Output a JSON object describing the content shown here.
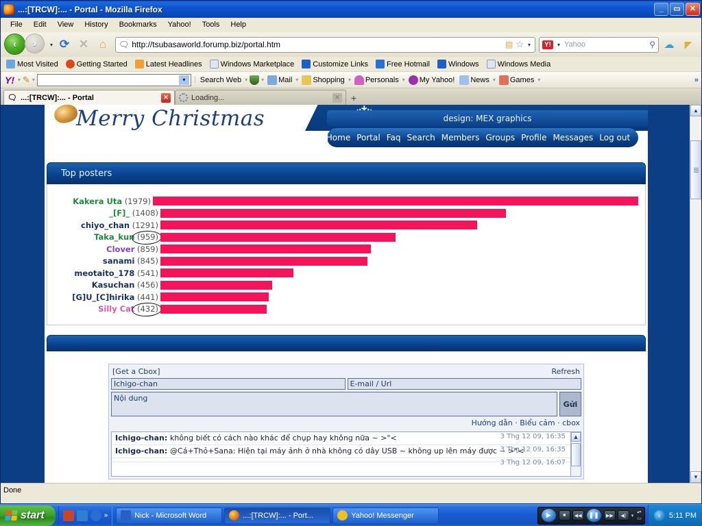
{
  "window": {
    "title": "...:[TRCW]:... - Portal - Mozilla Firefox",
    "minimize": "_",
    "maximize": "▭",
    "close": "✕"
  },
  "menu": [
    "File",
    "Edit",
    "View",
    "History",
    "Bookmarks",
    "Yahoo!",
    "Tools",
    "Help"
  ],
  "toolbar": {
    "back_icon": "‹",
    "forward_icon": "›",
    "reload_icon": "⟳",
    "stop_icon": "✕",
    "home_icon": "⌂",
    "url": "http://tsubasaworld.forump.biz/portal.htm",
    "feed_icon": "rss-icon",
    "star_icon": "☆",
    "search_placeholder": "Yahoo",
    "search_badge": "Y!",
    "search_icon": "search-icon",
    "skype_icon": "skype-icon",
    "megaphone_icon": "megaphone-icon"
  },
  "bookmarks": [
    {
      "label": "Most Visited",
      "icon": "globe-icon",
      "color": "#6aa9e0"
    },
    {
      "label": "Getting Started",
      "icon": "firefox-icon",
      "color": "#d94b1a"
    },
    {
      "label": "Latest Headlines",
      "icon": "rss-icon",
      "color": "#f2a033"
    },
    {
      "label": "Windows Marketplace",
      "icon": "page-icon",
      "color": "#dfe6f2"
    },
    {
      "label": "Customize Links",
      "icon": "msn-icon",
      "color": "#1d5fc4"
    },
    {
      "label": "Free Hotmail",
      "icon": "hotmail-icon",
      "color": "#2a6fd4"
    },
    {
      "label": "Windows",
      "icon": "msn-icon",
      "color": "#1d5fc4"
    },
    {
      "label": "Windows Media",
      "icon": "page-icon",
      "color": "#dfe6f2"
    }
  ],
  "yahoo_toolbar": {
    "logo": "Y!",
    "pencil_icon": "pencil-icon",
    "search_value": "",
    "items": [
      {
        "label": "Search Web",
        "icon": "search-web-icon",
        "color": "#2f6fbf"
      },
      {
        "label": "",
        "icon": "shield-icon",
        "color": "#4b7a3a"
      },
      {
        "label": "Mail",
        "icon": "envelope-icon",
        "color": "#7fa8dd"
      },
      {
        "label": "Shopping",
        "icon": "bag-icon",
        "color": "#e8c558"
      },
      {
        "label": "Personals",
        "icon": "heart-icon",
        "color": "#d060c0"
      },
      {
        "label": "My Yahoo!",
        "icon": "my-yahoo-icon",
        "color": "#9b2fb0"
      },
      {
        "label": "News",
        "icon": "news-icon",
        "color": "#9fc0e8"
      },
      {
        "label": "Games",
        "icon": "dice-icon",
        "color": "#e0705a"
      }
    ],
    "overflow": "»"
  },
  "tabs": [
    {
      "label": "...:[TRCW]:... - Portal",
      "active": true,
      "close": "✕",
      "icon": "speech-bubble-icon"
    },
    {
      "label": "Loading...",
      "active": false,
      "close": "✕",
      "icon": "spinner-icon"
    }
  ],
  "tab_new": "+",
  "site": {
    "banner_text": "Merry Christmas",
    "design_credit": "design: MEX graphics",
    "snowflake_icon": "snowflake-icon",
    "nav": [
      "Home",
      "Portal",
      "Faq",
      "Search",
      "Members",
      "Groups",
      "Profile",
      "Messages",
      "Log out"
    ]
  },
  "chart_data": {
    "type": "bar",
    "title": "Top posters",
    "orientation": "horizontal",
    "categories": [
      "Kakera Uta",
      "_[F]_",
      "chiyo_chan",
      "Taka_kun",
      "Clover",
      "sanami",
      "meotaito_178",
      "Kasuchan",
      "[G]U_[C]hirika",
      "Silly Cat"
    ],
    "values": [
      1979,
      1408,
      1291,
      959,
      859,
      845,
      541,
      456,
      441,
      432
    ],
    "max_value": 1979,
    "bar_color": "#f4145b",
    "name_colors": [
      "#1f8a3c",
      "#1f8a3c",
      "#18305e",
      "#1f8a3c",
      "#8a3fbf",
      "#18305e",
      "#18305e",
      "#18305e",
      "#18305e",
      "#e058a8"
    ],
    "annotations": [
      {
        "target": "Taka_kun",
        "value": 959,
        "shape": "hand-drawn-ellipse"
      },
      {
        "target": "Silly Cat",
        "value": 432,
        "shape": "hand-drawn-ellipse"
      }
    ],
    "xlabel": "",
    "ylabel": "",
    "grid": false,
    "legend": false
  },
  "cbox": {
    "get_link": "[Get a Cbox]",
    "refresh": "Refresh",
    "name_value": "Ichigo-chan",
    "email_placeholder": "E-mail / Url",
    "message_placeholder": "Nội dung",
    "send_label": "Gửi",
    "footer": "Hướng dẫn · Biểu cảm · cbox",
    "messages": [
      {
        "time": "3 Thg 12 09, 16:35",
        "user": "Ichigo-chan",
        "text": "không biết có cách nào khác để chụp hay không nữa ~ >\"<"
      },
      {
        "time": "3 Thg 12 09, 16:35",
        "user": "Ichigo-chan",
        "text": "@Cá+Thỏ+Sana: Hiện tại máy ảnh ở nhà không có dây USB ~ không up lên máy được ~ >\"<"
      },
      {
        "time": "3 Thg 12 09, 16:07",
        "user": "",
        "text": ""
      }
    ]
  },
  "status": "Done",
  "taskbar": {
    "start": "start",
    "quick_launch": [
      {
        "icon": "media-icon",
        "color": "#c8452a"
      },
      {
        "icon": "player-icon",
        "color": "#2f7fd0"
      },
      {
        "icon": "ie-icon",
        "color": "#2a6ecf"
      }
    ],
    "quick_overflow": "»",
    "tasks": [
      {
        "label": "Nick - Microsoft Word",
        "icon": "word-icon",
        "color": "#2a5fc4",
        "active": false
      },
      {
        "label": "...:[TRCW]:... - Port...",
        "icon": "firefox-icon",
        "color": "#e0721a",
        "active": true
      },
      {
        "label": "Yahoo! Messenger",
        "icon": "messenger-icon",
        "color": "#f0c020",
        "active": false
      }
    ],
    "media_player": {
      "stop": "■",
      "prev": "◀◀",
      "pause": "❚❚",
      "next": "▶▶",
      "volume": "◀)",
      "caret": "▾"
    },
    "tray_arrow": "‹",
    "clock": "5:11 PM"
  }
}
